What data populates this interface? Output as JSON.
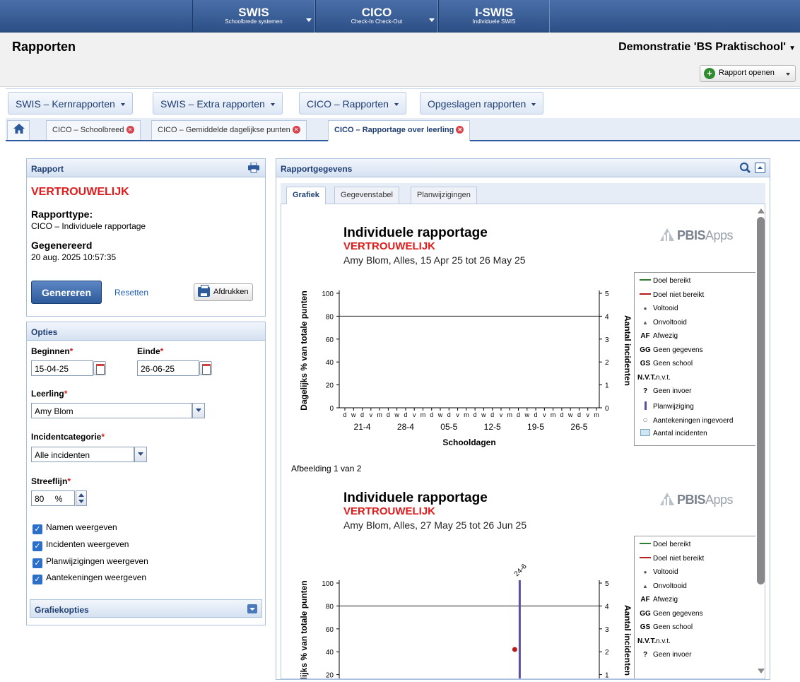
{
  "topnav": [
    {
      "title": "SWIS",
      "subtitle": "Schoolbrede systemen"
    },
    {
      "title": "CICO",
      "subtitle": "Check-In Check-Out"
    },
    {
      "title": "I-SWIS",
      "subtitle": "Individuele SWIS"
    }
  ],
  "header": {
    "title": "Rapporten",
    "school": "Demonstratie 'BS Praktischool'",
    "open_report": "Rapport openen"
  },
  "menus": [
    "SWIS – Kernrapporten",
    "SWIS – Extra rapporten",
    "CICO – Rapporten",
    "Opgeslagen rapporten"
  ],
  "tabs": [
    "CICO – Schoolbreed",
    "CICO – Gemiddelde dagelijkse punten",
    "CICO – Rapportage over leerling"
  ],
  "report_panel": {
    "title": "Rapport",
    "confidential": "VERTROUWELIJK",
    "type_label": "Rapporttype:",
    "type_value": "CICO – Individuele rapportage",
    "generated_label": "Gegenereerd",
    "generated_value": "20 aug. 2025 10:57:35",
    "generate_btn": "Genereren",
    "reset_link": "Resetten",
    "print_btn": "Afdrukken"
  },
  "options": {
    "title": "Opties",
    "begin_label": "Beginnen",
    "begin_value": "15-04-25",
    "end_label": "Einde",
    "end_value": "26-06-25",
    "student_label": "Leerling",
    "student_value": "Amy Blom",
    "category_label": "Incidentcategorie",
    "category_value": "Alle incidenten",
    "goal_label": "Streeflijn",
    "goal_value": "80",
    "goal_unit": "%",
    "checkboxes": [
      "Namen weergeven",
      "Incidenten weergeven",
      "Planwijzigingen weergeven",
      "Aantekeningen weergeven"
    ],
    "graph_options": "Grafiekopties"
  },
  "data_panel": {
    "title": "Rapportgegevens",
    "tabs": [
      "Grafiek",
      "Gegevenstabel",
      "Planwijzigingen"
    ]
  },
  "logo": {
    "bold": "PBIS",
    "light": "Apps"
  },
  "legend": [
    {
      "sym": "",
      "label": "Doel bereikt"
    },
    {
      "sym": "",
      "label": "Doel niet bereikt"
    },
    {
      "sym": "●",
      "label": "Voltooid"
    },
    {
      "sym": "▲",
      "label": "Onvoltooid"
    },
    {
      "sym": "AF",
      "label": "Afwezig"
    },
    {
      "sym": "GG",
      "label": "Geen gegevens"
    },
    {
      "sym": "GS",
      "label": "Geen school"
    },
    {
      "sym": "N.V.T.",
      "label": "n.v.t."
    },
    {
      "sym": "?",
      "label": "Geen invoer"
    },
    {
      "sym": "",
      "label": "Planwijziging"
    },
    {
      "sym": "○",
      "label": "Aantekeningen ingevoerd"
    },
    {
      "sym": "",
      "label": "Aantal incidenten"
    }
  ],
  "chart_data": [
    {
      "type": "line",
      "title": "Individuele rapportage",
      "subtitle": "VERTROUWELIJK",
      "caption": "Amy Blom, Alles, 15 Apr 25 tot 26 May 25",
      "xlabel": "Schooldagen",
      "ylabel": "Dagelijks % van totale punten",
      "y2label": "Aantal incidenten",
      "ylim": [
        0,
        100
      ],
      "y2lim": [
        0,
        5
      ],
      "yticks": [
        0,
        20,
        40,
        60,
        80,
        100
      ],
      "y2ticks": [
        0,
        1,
        2,
        3,
        4,
        5
      ],
      "day_ticks": [
        "d",
        "w",
        "d",
        "v",
        "m",
        "d",
        "w",
        "d",
        "v",
        "m",
        "d",
        "w",
        "d",
        "v",
        "m",
        "d",
        "w",
        "d",
        "v",
        "m",
        "d",
        "w",
        "d",
        "v",
        "m",
        "d",
        "w",
        "d",
        "v",
        "m"
      ],
      "week_labels": [
        "21-4",
        "28-4",
        "05-5",
        "12-5",
        "19-5",
        "26-5"
      ],
      "goal_line": 80,
      "series": [],
      "footer": "Afbeelding 1 van 2"
    },
    {
      "type": "line",
      "title": "Individuele rapportage",
      "subtitle": "VERTROUWELIJK",
      "caption": "Amy Blom, Alles, 27 May 25 tot 26 Jun 25",
      "ylabel": "Dagelijks % van totale punten",
      "y2label": "Aantal incidenten",
      "ylim": [
        0,
        100
      ],
      "y2lim": [
        0,
        5
      ],
      "yticks": [
        20,
        40,
        60,
        80,
        100
      ],
      "y2ticks": [
        1,
        2,
        3,
        4,
        5
      ],
      "goal_line": 80,
      "plan_change": {
        "label": "24-6"
      },
      "points": [
        {
          "x": "24-6",
          "y": 42
        }
      ]
    }
  ]
}
